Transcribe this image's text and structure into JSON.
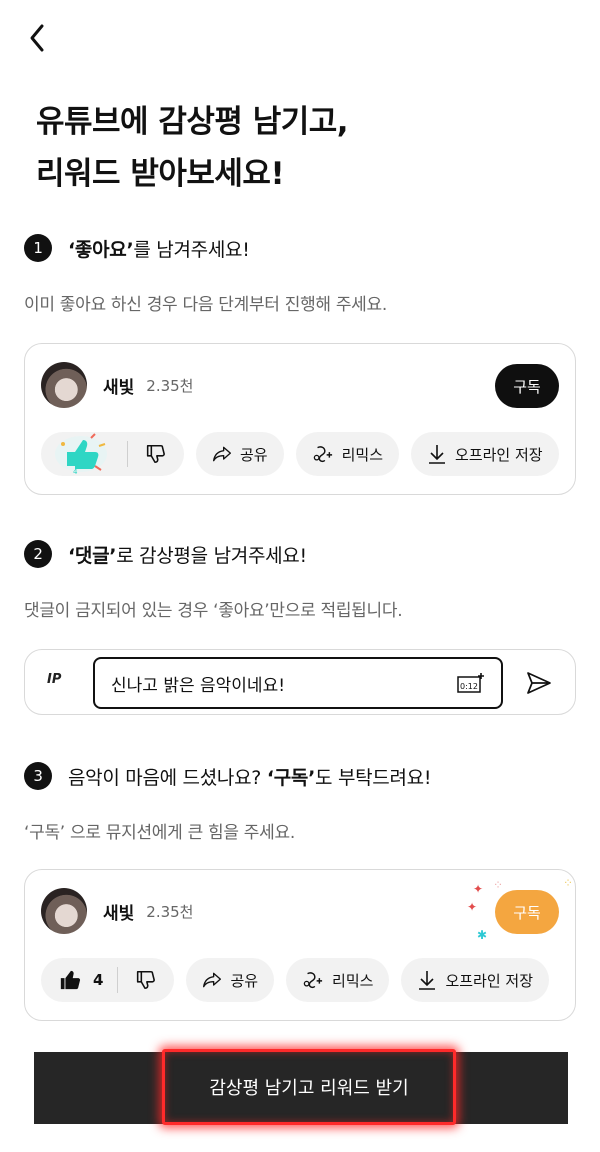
{
  "headline": {
    "line1": "유튜브에 감상평 남기고,",
    "line2": "리워드 받아보세요!"
  },
  "steps": [
    {
      "num": "1",
      "bold": "‘좋아요’",
      "rest": "를 남겨주세요!",
      "desc": "이미 좋아요 하신 경우 다음 단계부터 진행해 주세요."
    },
    {
      "num": "2",
      "bold": "‘댓글’",
      "rest": "로 감상평을 남겨주세요!",
      "desc": "댓글이 금지되어 있는 경우 ‘좋아요’만으로 적립됩니다."
    },
    {
      "num": "3",
      "pre": "음악이 마음에 드셨나요? ",
      "bold": "‘구독’",
      "rest": "도 부탁드려요!",
      "desc": "‘구독’ 으로 뮤지션에게 큰 힘을 주세요."
    }
  ],
  "channel": {
    "name": "새빛",
    "subs": "2.35천",
    "subscribe_label": "구독"
  },
  "actions": {
    "like_count": "4",
    "share": "공유",
    "remix": "리믹스",
    "offline": "오프라인 저장"
  },
  "comment": {
    "avatar_text": "IP",
    "text": "신나고 밝은 음악이네요!",
    "timestamp_icon": "0:12"
  },
  "cta": {
    "label": "감상평 남기고 리워드 받기"
  },
  "colors": {
    "accent_orange": "#f4a640",
    "cta_glow": "#ff2a2a",
    "bottom_bar": "#262626"
  }
}
